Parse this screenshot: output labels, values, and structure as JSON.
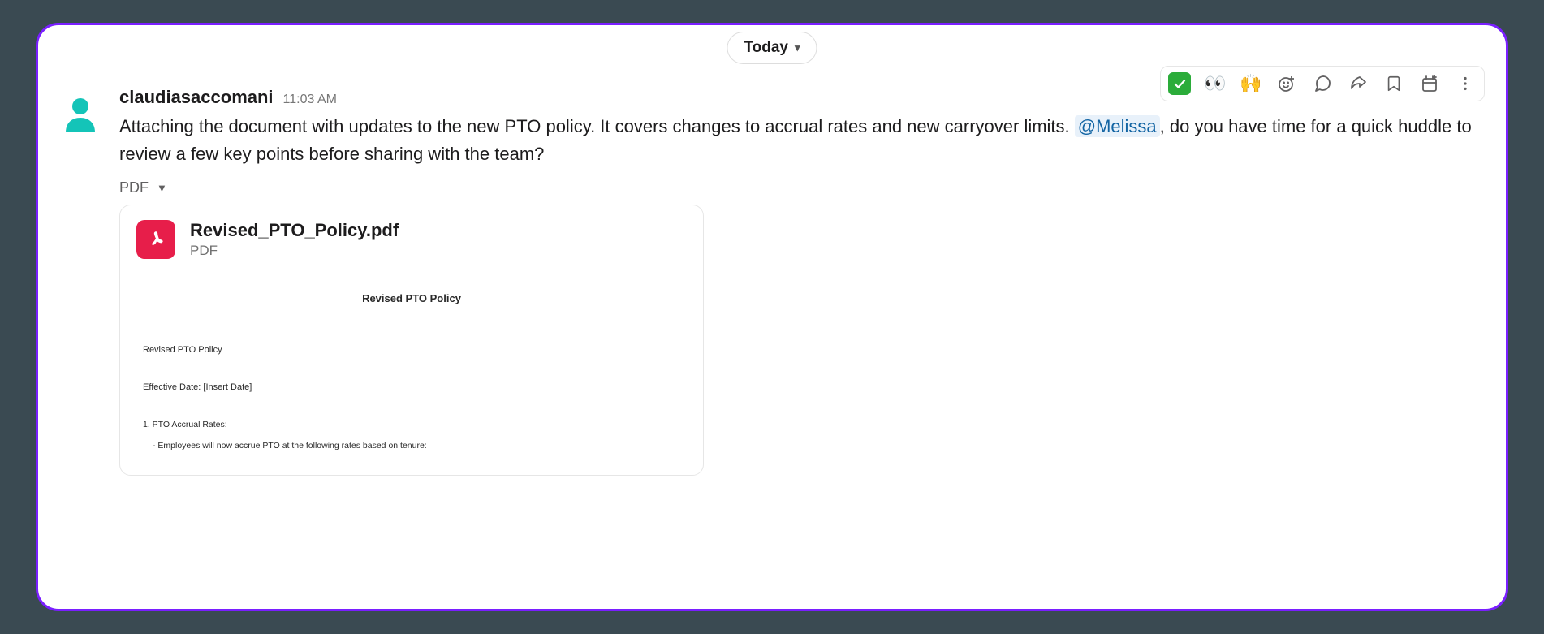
{
  "divider": {
    "label": "Today"
  },
  "message": {
    "username": "claudiasaccomani",
    "timestamp": "11:03 AM",
    "text_part1": "Attaching the document with updates to the new PTO policy. It covers changes to accrual rates and new carryover limits. ",
    "mention": "@Melissa",
    "text_part2": ", do you have time for a quick huddle to review a few key points before sharing with the team?"
  },
  "file_section_label": "PDF",
  "attachment": {
    "filename": "Revised_PTO_Policy.pdf",
    "filetype": "PDF",
    "preview": {
      "title": "Revised PTO Policy",
      "line1": "Revised PTO Policy",
      "line2": "Effective Date: [Insert Date]",
      "line3": "1. PTO Accrual Rates:",
      "line4": "- Employees will now accrue PTO at the following rates based on tenure:"
    }
  },
  "actions": {
    "check": "check-icon",
    "eyes": "eyes-icon",
    "hands": "raised-hands-icon",
    "react": "add-reaction-icon",
    "thread": "thread-icon",
    "share": "share-icon",
    "bookmark": "bookmark-icon",
    "remind": "remind-icon",
    "more": "more-icon"
  }
}
